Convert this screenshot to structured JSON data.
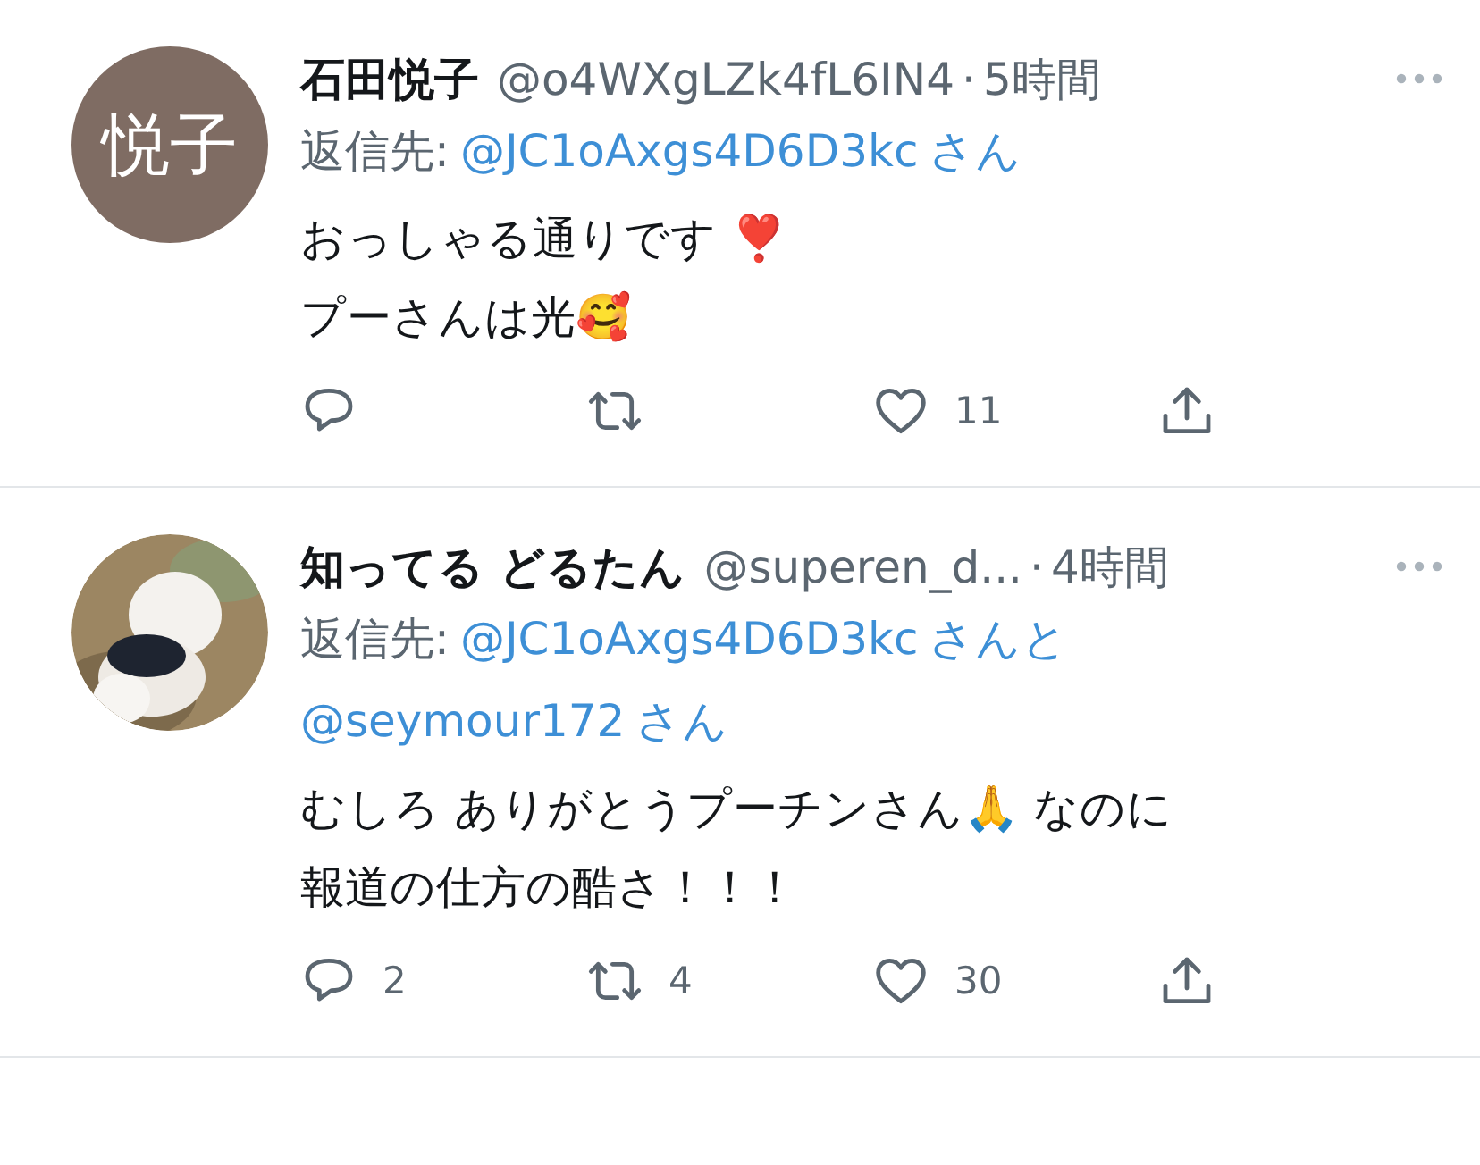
{
  "tweets": [
    {
      "avatar": {
        "kind": "initials",
        "text": "悦子"
      },
      "name": "石田悦子",
      "handle": "@o4WXgLZk4fL6IN4",
      "separator": "·",
      "time": "5時間",
      "reply_label": "返信先:",
      "reply_to": [
        {
          "handle": "@JC1oAxgs4D6D3kc",
          "suffix": "さん"
        }
      ],
      "body": [
        "おっしゃる通りです ❣️",
        "プーさんは光🥰"
      ],
      "actions": {
        "likes": "11"
      }
    },
    {
      "name": "知ってる どるたん",
      "handle": "@superen_d...",
      "separator": "·",
      "time": "4時間",
      "reply_label": "返信先:",
      "reply_to": [
        {
          "handle": "@JC1oAxgs4D6D3kc",
          "suffix": "さんと"
        },
        {
          "handle": "@seymour172",
          "suffix": "さん"
        }
      ],
      "body": [
        "むしろ ありがとうプーチンさん🙏 なのに",
        "報道の仕方の酷さ！！！"
      ],
      "actions": {
        "replies": "2",
        "retweets": "4",
        "likes": "30"
      }
    }
  ]
}
